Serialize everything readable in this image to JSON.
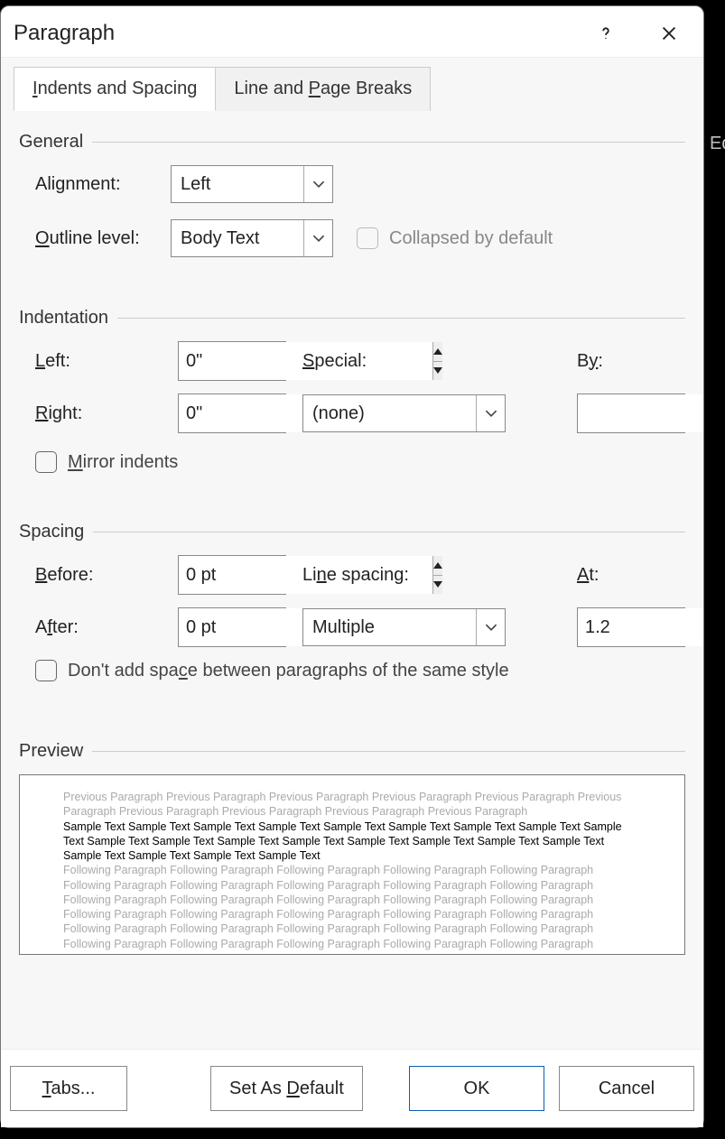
{
  "title": "Paragraph",
  "bg_text": "Ed",
  "tabs": {
    "indents": "Indents and Spacing",
    "breaks": "Line and Page Breaks"
  },
  "general": {
    "title": "General",
    "alignment_label": "Alignment:",
    "alignment_value": "Left",
    "outline_label": "Outline level:",
    "outline_value": "Body Text",
    "collapsed_label": "Collapsed by default"
  },
  "indentation": {
    "title": "Indentation",
    "left_label": "Left:",
    "left_value": "0\"",
    "right_label": "Right:",
    "right_value": "0\"",
    "special_label": "Special:",
    "special_value": "(none)",
    "by_label": "By:",
    "by_value": "",
    "mirror_label": "Mirror indents"
  },
  "spacing": {
    "title": "Spacing",
    "before_label": "Before:",
    "before_value": "0 pt",
    "after_label": "After:",
    "after_value": "0 pt",
    "line_label": "Line spacing:",
    "line_value": "Multiple",
    "at_label": "At:",
    "at_value": "1.2",
    "noadd_label": "Don't add space between paragraphs of the same style"
  },
  "preview": {
    "title": "Preview",
    "prev": "Previous Paragraph Previous Paragraph Previous Paragraph Previous Paragraph Previous Paragraph Previous Paragraph Previous Paragraph Previous Paragraph Previous Paragraph Previous Paragraph",
    "sample": "Sample Text Sample Text Sample Text Sample Text Sample Text Sample Text Sample Text Sample Text Sample Text Sample Text Sample Text Sample Text Sample Text Sample Text Sample Text Sample Text Sample Text Sample Text Sample Text Sample Text Sample Text",
    "next": "Following Paragraph Following Paragraph Following Paragraph Following Paragraph Following Paragraph Following Paragraph Following Paragraph Following Paragraph Following Paragraph Following Paragraph Following Paragraph Following Paragraph Following Paragraph Following Paragraph Following Paragraph Following Paragraph Following Paragraph Following Paragraph Following Paragraph Following Paragraph Following Paragraph Following Paragraph Following Paragraph Following Paragraph Following Paragraph Following Paragraph Following Paragraph Following Paragraph Following Paragraph Following Paragraph"
  },
  "footer": {
    "tabs": "Tabs...",
    "default": "Set As Default",
    "ok": "OK",
    "cancel": "Cancel"
  }
}
